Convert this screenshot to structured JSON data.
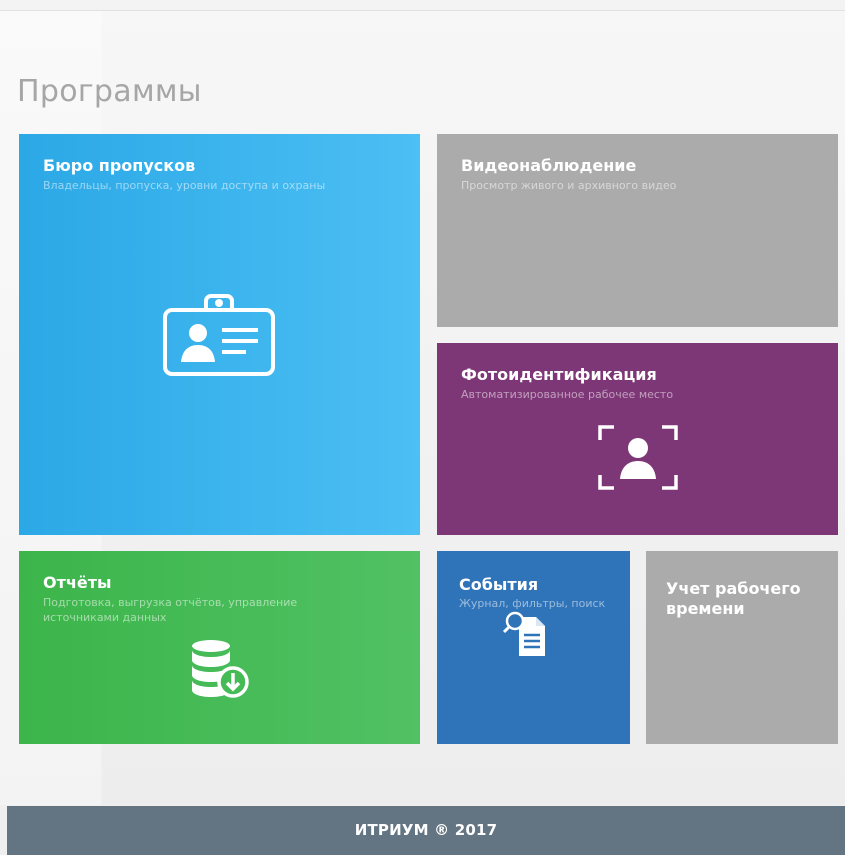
{
  "page": {
    "title": "Программы"
  },
  "tiles": {
    "bureau": {
      "title": "Бюро пропусков",
      "subtitle": "Владельцы, пропуска, уровни доступа и охраны",
      "icon": "badge-id-icon",
      "color": "#39b4f0"
    },
    "video": {
      "title": "Видеонаблюдение",
      "subtitle": "Просмотр живого и архивного видео",
      "color": "#ababab"
    },
    "photo": {
      "title": "Фотоидентификация",
      "subtitle": "Автоматизированное рабочее место",
      "icon": "face-scan-icon",
      "color": "#7d3676"
    },
    "reports": {
      "title": "Отчёты",
      "subtitle": "Подготовка, выгрузка отчётов, управление источниками данных",
      "icon": "database-download-icon",
      "color": "#45bb56"
    },
    "events": {
      "title": "События",
      "subtitle": "Журнал, фильтры, поиск",
      "icon": "document-search-icon",
      "color": "#2f73b8"
    },
    "time": {
      "title": "Учет рабочего времени",
      "color": "#ababab"
    }
  },
  "footer": {
    "text": "ИТРИУМ ® 2017",
    "color": "#637482"
  }
}
